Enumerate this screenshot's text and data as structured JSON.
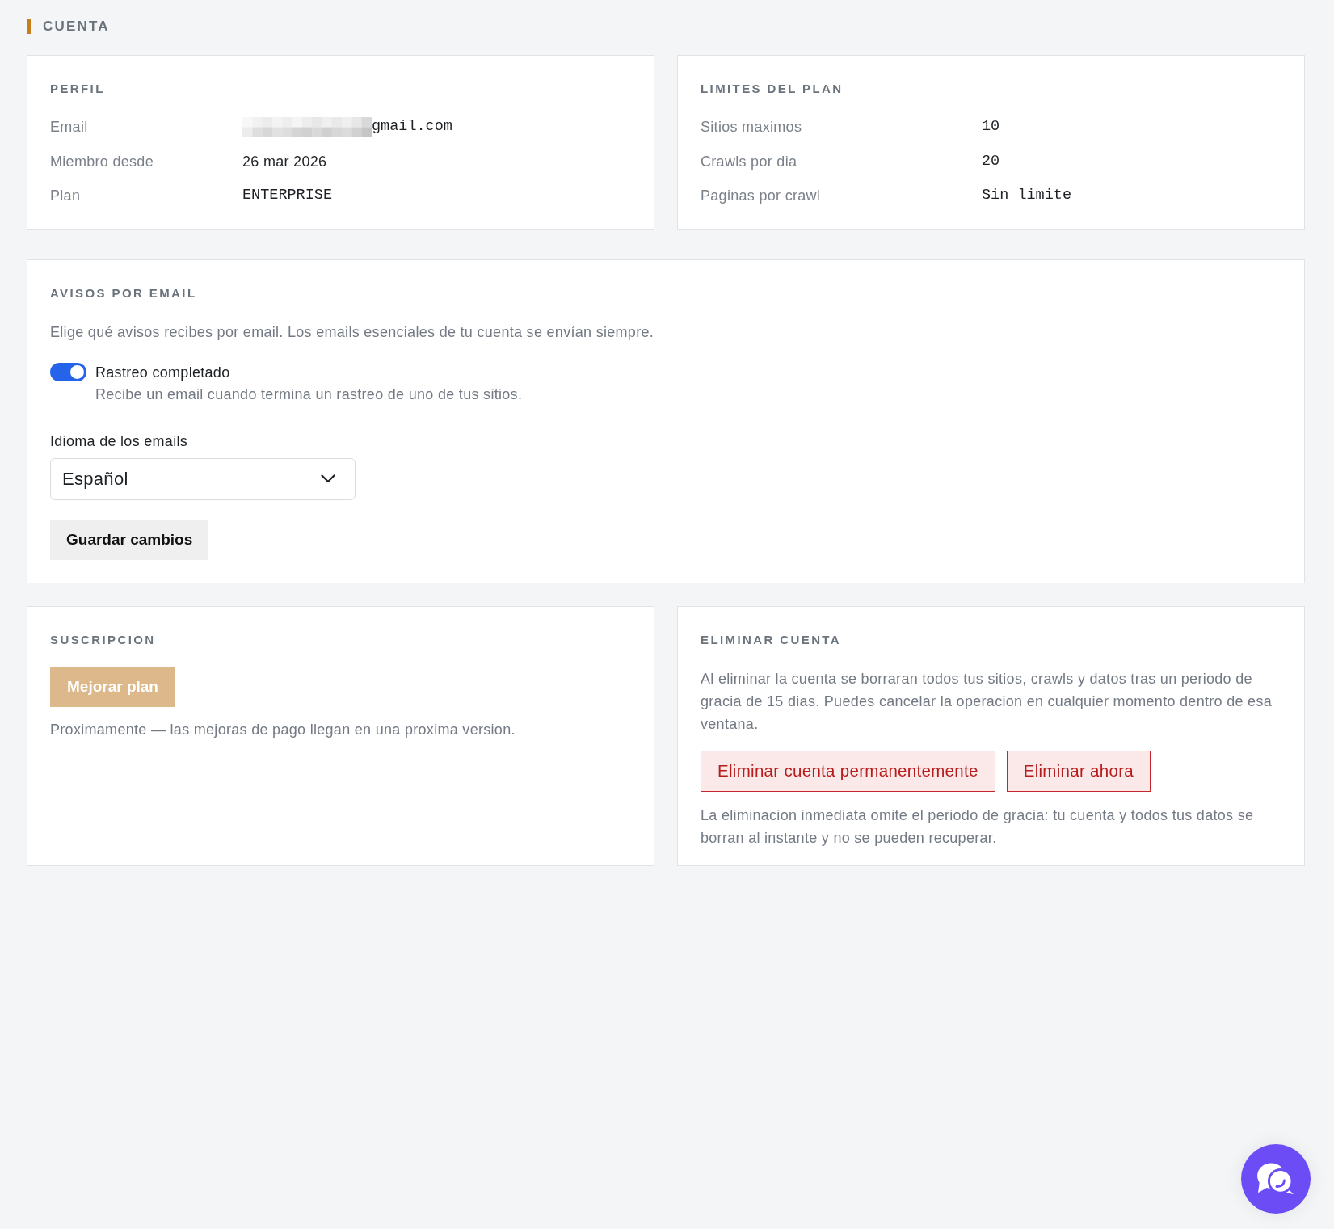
{
  "section": {
    "title": "CUENTA"
  },
  "profile": {
    "title": "PERFIL",
    "rows": [
      {
        "label": "Email",
        "value": "gmail.com",
        "kind": "masked"
      },
      {
        "label": "Miembro desde",
        "value": "26 mar 2026",
        "kind": "text"
      },
      {
        "label": "Plan",
        "value": "ENTERPRISE",
        "kind": "mono"
      }
    ]
  },
  "plan_limits": {
    "title": "LIMITES DEL PLAN",
    "rows": [
      {
        "label": "Sitios maximos",
        "value": "10",
        "kind": "mono"
      },
      {
        "label": "Crawls por dia",
        "value": "20",
        "kind": "mono"
      },
      {
        "label": "Paginas por crawl",
        "value": "Sin limite",
        "kind": "mono"
      }
    ]
  },
  "notifications": {
    "title": "AVISOS POR EMAIL",
    "description": "Elige qué avisos recibes por email. Los emails esenciales de tu cuenta se envían siempre.",
    "toggles": [
      {
        "label": "Rastreo completado",
        "hint": "Recibe un email cuando termina un rastreo de uno de tus sitios.",
        "on": true
      }
    ],
    "language": {
      "label": "Idioma de los emails",
      "value": "Español"
    },
    "save_button": {
      "label": "Guardar cambios"
    }
  },
  "subscription": {
    "title": "SUSCRIPCION",
    "upgrade_button": {
      "label": "Mejorar plan",
      "disabled": true
    },
    "note": "Proximamente — las mejoras de pago llegan en una proxima version."
  },
  "delete_account": {
    "title": "ELIMINAR CUENTA",
    "description": "Al eliminar la cuenta se borraran todos tus sitios, crawls y datos tras un periodo de gracia de 15 dias. Puedes cancelar la operacion en cualquier momento dentro de esa ventana.",
    "buttons": [
      {
        "label": "Eliminar cuenta permanentemente"
      },
      {
        "label": "Eliminar ahora"
      }
    ],
    "warning": "La eliminacion inmediata omite el periodo de gracia: tu cuenta y todos tus datos se borran al instante y no se pueden recuperar."
  }
}
